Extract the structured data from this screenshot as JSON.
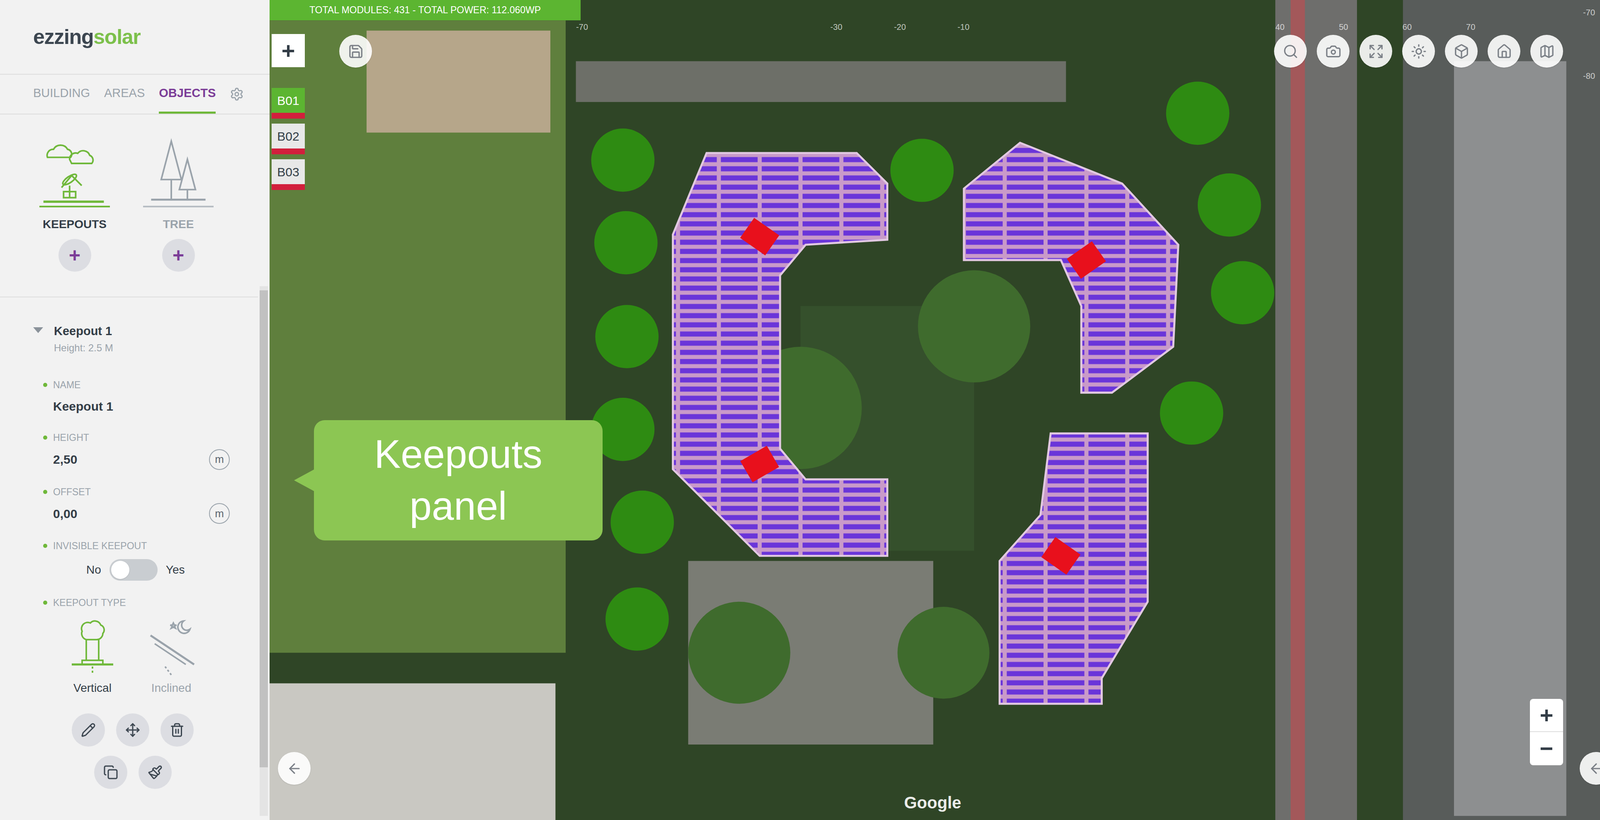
{
  "logo": {
    "main": "ezzing",
    "accent": "solar"
  },
  "tabs": [
    {
      "label": "BUILDING",
      "selected": false
    },
    {
      "label": "AREAS",
      "selected": false
    },
    {
      "label": "OBJECTS",
      "selected": true
    }
  ],
  "object_types": [
    {
      "label": "KEEPOUTS",
      "kind": "keepout",
      "selected": true,
      "add": "+"
    },
    {
      "label": "TREE",
      "kind": "tree",
      "selected": false,
      "add": "+"
    }
  ],
  "keepout": {
    "title": "Keepout 1",
    "subtitle": "Height: 2.5 M",
    "expanded": true,
    "fields": [
      {
        "kind": "text",
        "label": "NAME",
        "value": "Keepout 1"
      },
      {
        "kind": "number",
        "label": "HEIGHT",
        "value": "2,50",
        "unit": "m"
      },
      {
        "kind": "number",
        "label": "OFFSET",
        "value": "0,00",
        "unit": "m"
      },
      {
        "kind": "toggle",
        "label": "INVISIBLE KEEPOUT",
        "off_label": "No",
        "on_label": "Yes",
        "on": false
      },
      {
        "kind": "choice",
        "label": "KEEPOUT TYPE",
        "options": [
          {
            "label": "Vertical",
            "kind": "vertical",
            "selected": true
          },
          {
            "label": "Inclined",
            "kind": "inclined",
            "selected": false
          }
        ]
      }
    ]
  },
  "callout": "Keepouts panel",
  "map": {
    "banner": "TOTAL MODULES: 431 - TOTAL POWER: 112.060WP",
    "add_button": "+",
    "buildings": [
      {
        "label": "B01",
        "selected": true
      },
      {
        "label": "B02",
        "selected": false
      },
      {
        "label": "B03",
        "selected": false
      }
    ],
    "ruler_top": [
      "-70",
      "-30",
      "-20",
      "-10",
      "40",
      "50",
      "60",
      "70"
    ],
    "ruler_right": [
      "-80",
      "-70"
    ],
    "zoom": {
      "in": "+",
      "out": "−"
    },
    "attribution": "Google"
  }
}
